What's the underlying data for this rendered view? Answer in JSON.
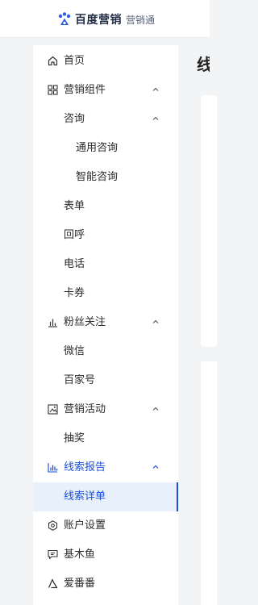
{
  "header": {
    "brand_main": "百度营销",
    "brand_sub": "营销通"
  },
  "main": {
    "title_partial": "线"
  },
  "sidebar": {
    "items": [
      {
        "label": "首页",
        "icon": "home-icon"
      },
      {
        "label": "营销组件",
        "icon": "grid-icon",
        "expanded": true
      },
      {
        "label": "咨询",
        "expanded": true
      },
      {
        "label": "通用咨询"
      },
      {
        "label": "智能咨询"
      },
      {
        "label": "表单"
      },
      {
        "label": "回呼"
      },
      {
        "label": "电话"
      },
      {
        "label": "卡券"
      },
      {
        "label": "粉丝关注",
        "icon": "bar-chart-icon",
        "expanded": true
      },
      {
        "label": "微信"
      },
      {
        "label": "百家号"
      },
      {
        "label": "营销活动",
        "icon": "image-frame-icon",
        "expanded": true
      },
      {
        "label": "抽奖"
      },
      {
        "label": "线索报告",
        "icon": "report-chart-icon",
        "expanded": true,
        "active": true
      },
      {
        "label": "线索详单",
        "selected": true
      },
      {
        "label": "账户设置",
        "icon": "settings-circle-icon"
      },
      {
        "label": "基木鱼",
        "icon": "message-square-icon"
      },
      {
        "label": "爱番番",
        "icon": "triangle-pen-icon"
      }
    ]
  },
  "colors": {
    "accent": "#1d4ed8",
    "selected_bg": "#e8f1fb",
    "page_bg": "#f3f4f6"
  }
}
